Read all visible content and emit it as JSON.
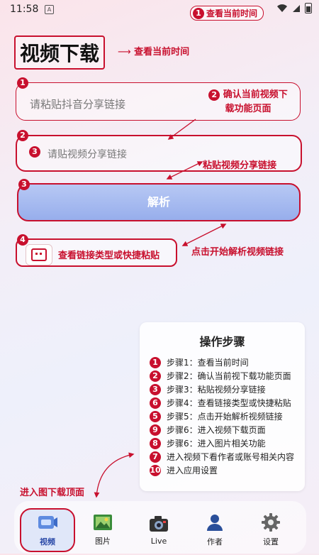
{
  "status": {
    "time": "11:58",
    "a_icon": "A"
  },
  "top_callout": {
    "num": "1",
    "text": "查看当前时间"
  },
  "title": "视频下载",
  "title_callout": "查看当前时间",
  "input1": {
    "num": "1",
    "placeholder": "请粘贴抖音分享链接"
  },
  "callout2": {
    "num": "2",
    "line1": "确认当前视频下",
    "line2": "载功能页面"
  },
  "input2": {
    "num_outer": "2",
    "num_inner": "3",
    "placeholder": "请贴视频分享链接"
  },
  "callout3": "粘贴视频分享链接",
  "parse": {
    "num": "3",
    "label": "解析"
  },
  "clip": {
    "num": "4",
    "text": "查看链接类型或快捷粘贴"
  },
  "callout_parse": "点击开始解析视频链接",
  "steps": {
    "title": "操作步骤",
    "items": [
      {
        "num": "1",
        "text": "步骤1：查看当前时间"
      },
      {
        "num": "2",
        "text": "步骤2：确认当前视下载功能页面"
      },
      {
        "num": "3",
        "text": "步骤3：粘贴视频分享链接"
      },
      {
        "num": "6",
        "text": "步骤4：查看链接类型或快捷粘贴"
      },
      {
        "num": "5",
        "text": "步骤5：点击开始解析视频链接"
      },
      {
        "num": "9",
        "text": "步骤6：进入视频下载页面"
      },
      {
        "num": "8",
        "text": "步骤6：进入图片相关功能"
      },
      {
        "num": "7",
        "text": "进入视频下看作者或账号相关内容"
      },
      {
        "num": "10",
        "text": "进入应用设置"
      }
    ]
  },
  "nav_callout": "进入图下载顶面",
  "nav": {
    "items": [
      {
        "label": "视频",
        "icon": "video-icon"
      },
      {
        "label": "图片",
        "icon": "image-icon"
      },
      {
        "label": "Live",
        "icon": "camera-icon"
      },
      {
        "label": "作者",
        "icon": "user-icon"
      },
      {
        "label": "设置",
        "icon": "gear-icon"
      }
    ]
  },
  "colors": {
    "accent": "#c8102e",
    "button": "#a3b8ee",
    "nav_active": "#2b4aa8"
  }
}
